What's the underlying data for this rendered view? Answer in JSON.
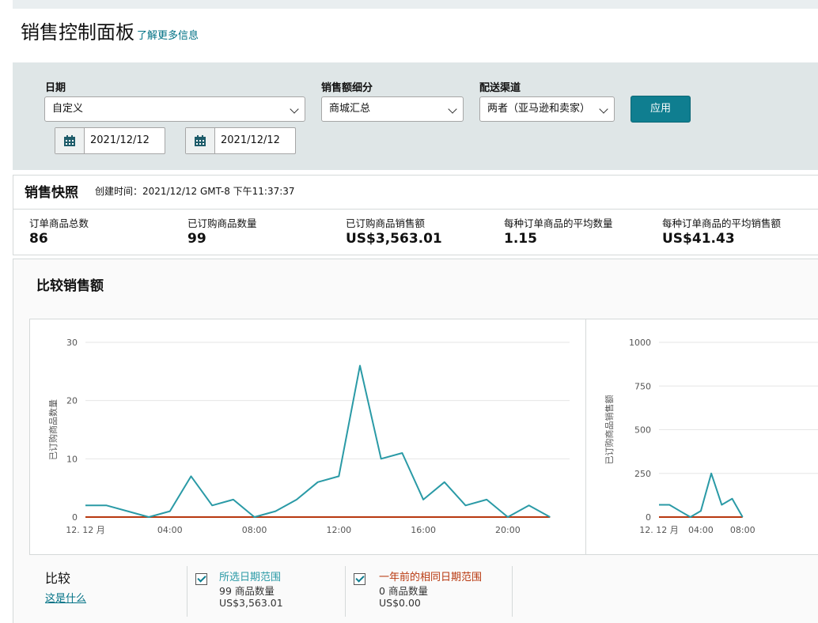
{
  "header": {
    "title": "销售控制面板",
    "learn_more": "了解更多信息"
  },
  "filters": {
    "date": {
      "label": "日期",
      "value": "自定义",
      "start": "2021/12/12",
      "end": "2021/12/12"
    },
    "breakdown": {
      "label": "销售额细分",
      "value": "商城汇总"
    },
    "channel": {
      "label": "配送渠道",
      "value": "两者（亚马逊和卖家）"
    },
    "apply_label": "应用"
  },
  "snapshot": {
    "title": "销售快照",
    "created": "创建时间：2021/12/12 GMT-8 下午11:37:37",
    "metrics": [
      {
        "label": "订单商品总数",
        "value": "86"
      },
      {
        "label": "已订购商品数量",
        "value": "99"
      },
      {
        "label": "已订购商品销售额",
        "value": "US$3,563.01"
      },
      {
        "label": "每种订单商品的平均数量",
        "value": "1.15"
      },
      {
        "label": "每种订单商品的平均销售额",
        "value": "US$41.43"
      }
    ]
  },
  "compare": {
    "title": "比较销售额",
    "label": "比较",
    "what_link": "这是什么",
    "legend": [
      {
        "title": "所选日期范围",
        "units_num": "99",
        "units_text": "商品数量",
        "sales": "US$3,563.01",
        "color": "#2a9aa6"
      },
      {
        "title": "一年前的相同日期范围",
        "units_num": "0",
        "units_text": "商品数量",
        "sales": "US$0.00",
        "color": "#b8380f"
      }
    ]
  },
  "chart_data": [
    {
      "type": "line",
      "ylabel": "已订购商品数量",
      "ylim": [
        0,
        30
      ],
      "yticks": [
        0,
        10,
        20,
        30
      ],
      "xlim": [
        0,
        23
      ],
      "xticks": [
        {
          "v": 0,
          "label": "12. 12 月"
        },
        {
          "v": 4,
          "label": "04:00"
        },
        {
          "v": 8,
          "label": "08:00"
        },
        {
          "v": 12,
          "label": "12:00"
        },
        {
          "v": 16,
          "label": "16:00"
        },
        {
          "v": 20,
          "label": "20:00"
        }
      ],
      "grid": true,
      "series": [
        {
          "name": "所选日期范围",
          "color": "#2a9aa6",
          "x": [
            0,
            1,
            2,
            3,
            4,
            5,
            6,
            7,
            8,
            9,
            10,
            11,
            12,
            13,
            14,
            15,
            16,
            17,
            18,
            19,
            20,
            21,
            22
          ],
          "y": [
            2,
            2,
            1,
            0,
            1,
            7,
            2,
            3,
            0,
            1,
            3,
            6,
            7,
            26,
            10,
            11,
            3,
            6,
            2,
            3,
            0,
            2,
            0
          ]
        },
        {
          "name": "一年前的相同日期范围",
          "color": "#b8380f",
          "x": [
            0,
            22
          ],
          "y": [
            0,
            0
          ]
        }
      ]
    },
    {
      "type": "line",
      "ylabel": "已订购商品销售额",
      "ylim": [
        0,
        1000
      ],
      "yticks": [
        0,
        250,
        500,
        750,
        1000
      ],
      "xlim": [
        0,
        23
      ],
      "xticks": [
        {
          "v": 0,
          "label": "12. 12 月"
        },
        {
          "v": 4,
          "label": "04:00"
        },
        {
          "v": 8,
          "label": "08:00"
        }
      ],
      "grid": true,
      "series": [
        {
          "name": "所选日期范围",
          "color": "#2a9aa6",
          "x": [
            0,
            1,
            2,
            3,
            4,
            5,
            6,
            7,
            8
          ],
          "y": [
            70,
            70,
            35,
            0,
            35,
            250,
            70,
            105,
            0
          ]
        },
        {
          "name": "一年前的相同日期范围",
          "color": "#b8380f",
          "x": [
            0,
            8
          ],
          "y": [
            0,
            0
          ]
        }
      ]
    }
  ]
}
